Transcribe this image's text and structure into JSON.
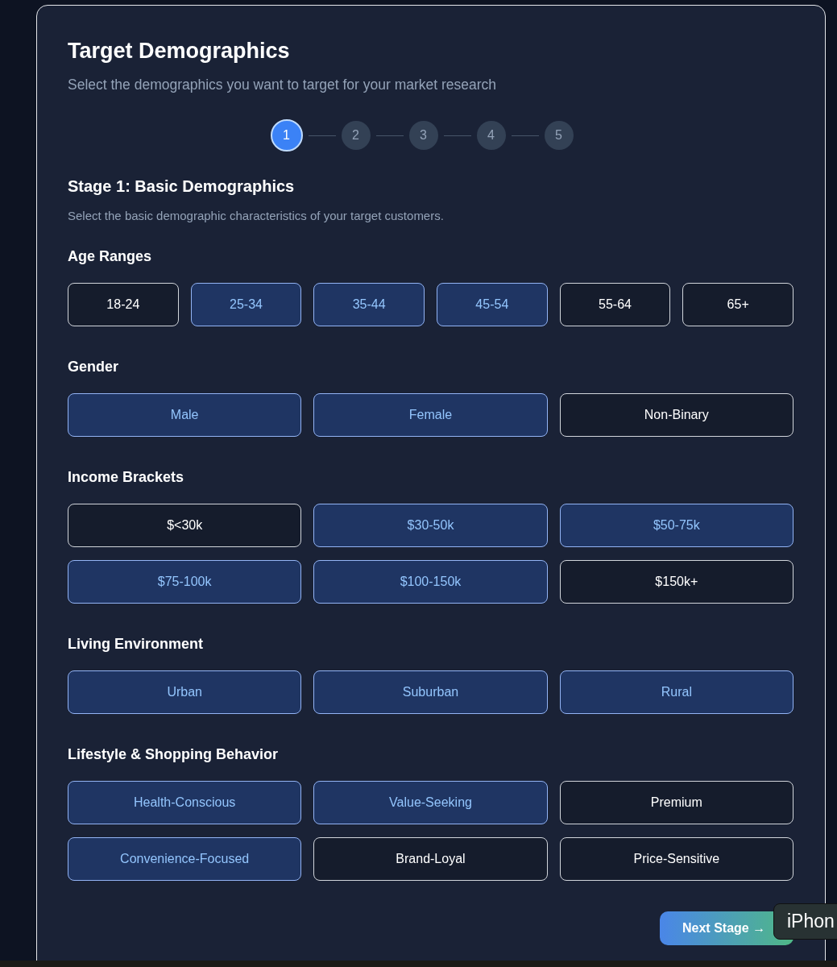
{
  "title": "Target Demographics",
  "subtitle": "Select the demographics you want to target for your market research",
  "steps": [
    {
      "label": "1",
      "selected": true
    },
    {
      "label": "2",
      "selected": false
    },
    {
      "label": "3",
      "selected": false
    },
    {
      "label": "4",
      "selected": false
    },
    {
      "label": "5",
      "selected": false
    }
  ],
  "stage": {
    "title": "Stage 1: Basic Demographics",
    "description": "Select the basic demographic characteristics of your target customers."
  },
  "sections": [
    {
      "label": "Age Ranges",
      "options": [
        {
          "label": "18-24",
          "selected": false
        },
        {
          "label": "25-34",
          "selected": true
        },
        {
          "label": "35-44",
          "selected": true
        },
        {
          "label": "45-54",
          "selected": true
        },
        {
          "label": "55-64",
          "selected": false
        },
        {
          "label": "65+",
          "selected": false
        }
      ]
    },
    {
      "label": "Gender",
      "options": [
        {
          "label": "Male",
          "selected": true
        },
        {
          "label": "Female",
          "selected": true
        },
        {
          "label": "Non-Binary",
          "selected": false
        }
      ]
    },
    {
      "label": "Income Brackets",
      "options": [
        {
          "label": "$<30k",
          "selected": false
        },
        {
          "label": "$30-50k",
          "selected": true
        },
        {
          "label": "$50-75k",
          "selected": true
        },
        {
          "label": "$75-100k",
          "selected": true
        },
        {
          "label": "$100-150k",
          "selected": true
        },
        {
          "label": "$150k+",
          "selected": false
        }
      ]
    },
    {
      "label": "Living Environment",
      "options": [
        {
          "label": "Urban",
          "selected": true
        },
        {
          "label": "Suburban",
          "selected": true
        },
        {
          "label": "Rural",
          "selected": true
        }
      ]
    },
    {
      "label": "Lifestyle & Shopping Behavior",
      "options": [
        {
          "label": "Health-Conscious",
          "selected": true
        },
        {
          "label": "Value-Seeking",
          "selected": true
        },
        {
          "label": "Premium",
          "selected": false
        },
        {
          "label": "Convenience-Focused",
          "selected": true
        },
        {
          "label": "Brand-Loyal",
          "selected": false
        },
        {
          "label": "Price-Sensitive",
          "selected": false
        }
      ]
    }
  ],
  "next_button": "Next Stage →",
  "tooltip": "iPhon"
}
